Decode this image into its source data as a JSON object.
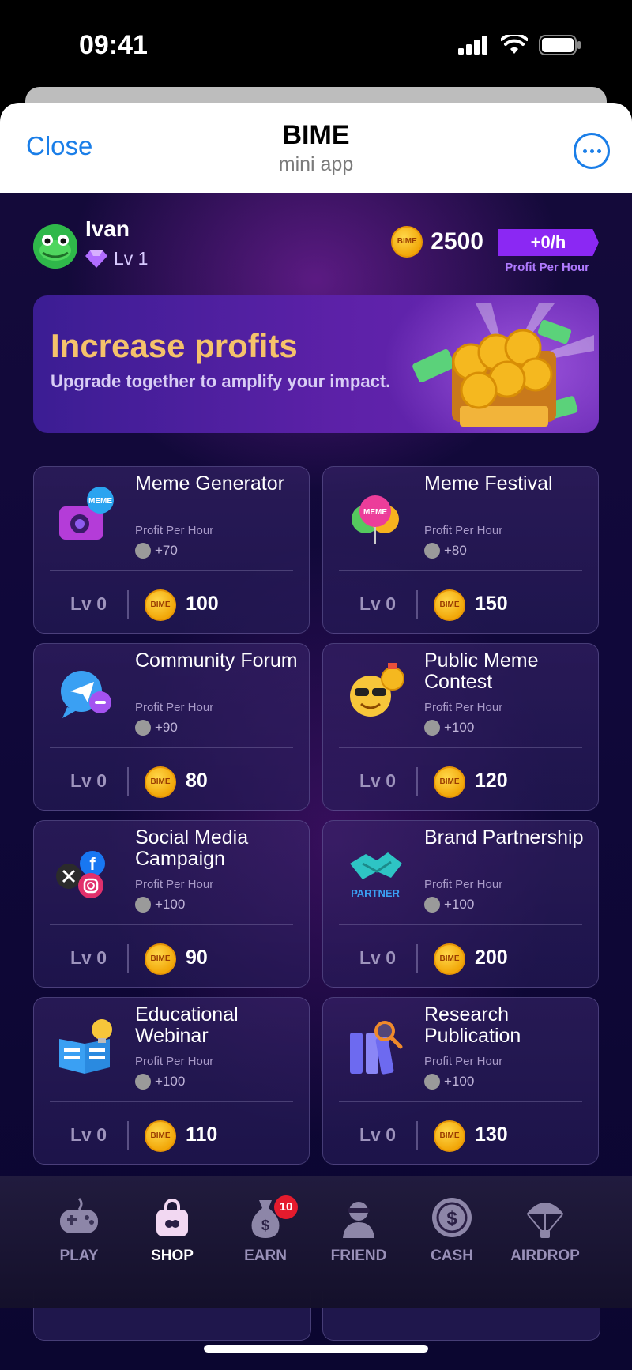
{
  "status": {
    "time": "09:41"
  },
  "header": {
    "close_label": "Close",
    "title": "BIME",
    "subtitle": "mini app"
  },
  "user": {
    "name": "Ivan",
    "level": "Lv 1",
    "balance": "2500",
    "profit_per_hour": "+0/h",
    "profit_per_hour_label": "Profit Per Hour"
  },
  "banner": {
    "title": "Increase profits",
    "subtitle": "Upgrade together to amplify your impact."
  },
  "coin_text": "BIME",
  "cards": [
    {
      "name": "Meme Generator",
      "pph_label": "Profit Per Hour",
      "pph": "+70",
      "level": "Lv 0",
      "cost": "100",
      "icon": "camera-meme-icon"
    },
    {
      "name": "Meme Festival",
      "pph_label": "Profit Per Hour",
      "pph": "+80",
      "level": "Lv 0",
      "cost": "150",
      "icon": "balloon-icon"
    },
    {
      "name": "Community Forum",
      "pph_label": "Profit Per Hour",
      "pph": "+90",
      "level": "Lv 0",
      "cost": "80",
      "icon": "chat-bubble-icon"
    },
    {
      "name": "Public Meme Contest",
      "pph_label": "Profit Per Hour",
      "pph": "+100",
      "level": "Lv 0",
      "cost": "120",
      "icon": "emoji-medal-icon"
    },
    {
      "name": "Social Media Campaign",
      "pph_label": "Profit Per Hour",
      "pph": "+100",
      "level": "Lv 0",
      "cost": "90",
      "icon": "social-logos-icon"
    },
    {
      "name": "Brand Partnership",
      "pph_label": "Profit Per Hour",
      "pph": "+100",
      "level": "Lv 0",
      "cost": "200",
      "icon": "handshake-partner-icon"
    },
    {
      "name": "Educational Webinar",
      "pph_label": "Profit Per Hour",
      "pph": "+100",
      "level": "Lv 0",
      "cost": "110",
      "icon": "book-bulb-icon"
    },
    {
      "name": "Research Publication",
      "pph_label": "Profit Per Hour",
      "pph": "+100",
      "level": "Lv 0",
      "cost": "130",
      "icon": "binders-magnifier-icon"
    }
  ],
  "nav": {
    "items": [
      {
        "label": "PLAY",
        "icon": "gamepad-icon"
      },
      {
        "label": "SHOP",
        "icon": "shopping-bag-icon",
        "active": true
      },
      {
        "label": "EARN",
        "icon": "money-bag-icon",
        "badge": "10"
      },
      {
        "label": "FRIEND",
        "icon": "person-icon"
      },
      {
        "label": "CASH",
        "icon": "dollar-coin-icon"
      },
      {
        "label": "AIRDROP",
        "icon": "parachute-icon"
      }
    ]
  },
  "colors": {
    "accent": "#8b28f3",
    "link": "#1a7ee8",
    "gold": "#f5c26b",
    "badge": "#e41b2d"
  }
}
